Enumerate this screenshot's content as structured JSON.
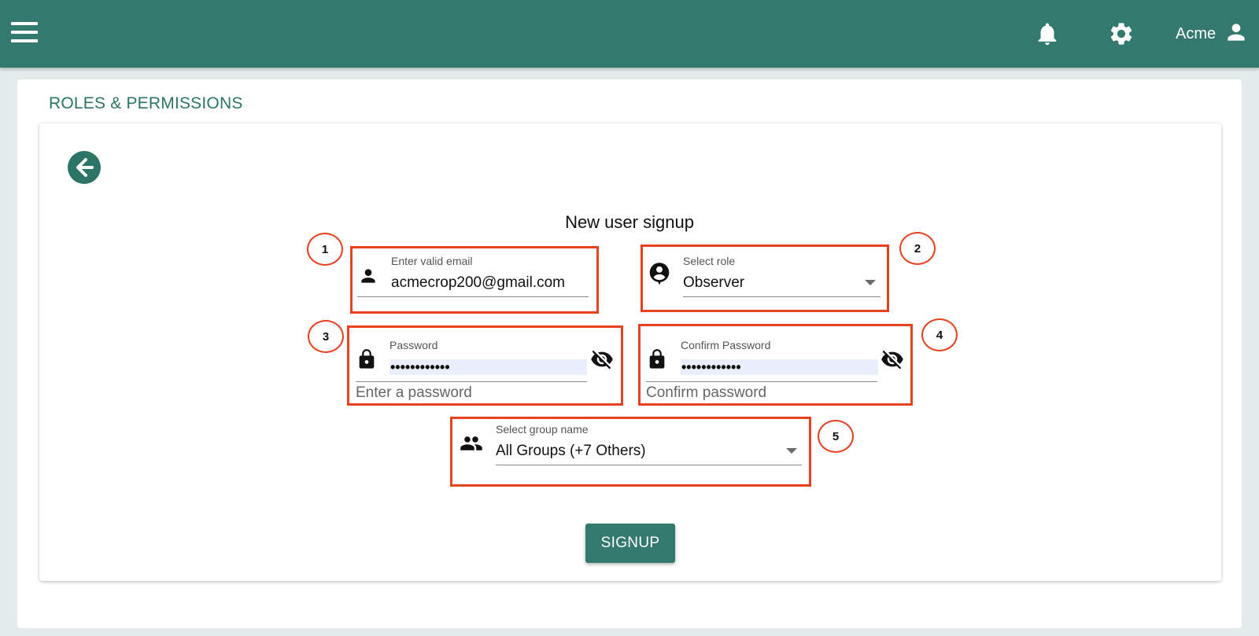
{
  "header": {
    "user_name": "Acme",
    "icons": {
      "menu": "menu-icon",
      "notifications": "bell-icon",
      "settings": "gear-icon",
      "account": "person-icon"
    },
    "bg_color": "#33796d"
  },
  "page": {
    "section_title": "ROLES & PERMISSIONS",
    "form_title": "New user signup"
  },
  "form": {
    "email": {
      "label": "Enter valid email",
      "value": "acmecrop200@gmail.com"
    },
    "role": {
      "label": "Select role",
      "value": "Observer"
    },
    "password": {
      "label": "Password",
      "value": "••••••••••••",
      "helper": "Enter a password"
    },
    "confirm_password": {
      "label": "Confirm Password",
      "value": "••••••••••••",
      "helper": "Confirm password"
    },
    "group": {
      "label": "Select group name",
      "value": "All Groups (+7 Others)"
    },
    "submit_label": "SIGNUP"
  },
  "annotations": [
    "1",
    "2",
    "3",
    "4",
    "5"
  ],
  "colors": {
    "accent": "#2c7465",
    "annotation": "#e8411f"
  }
}
